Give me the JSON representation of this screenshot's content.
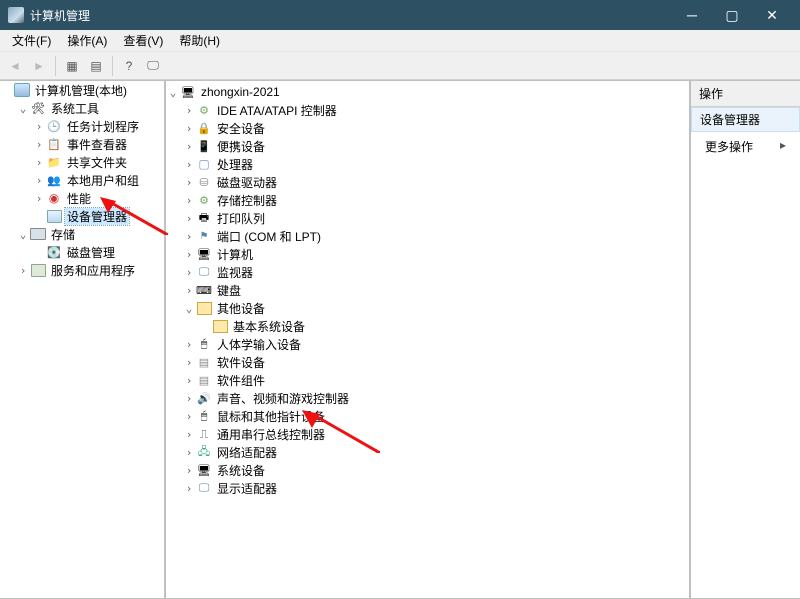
{
  "window": {
    "title": "计算机管理"
  },
  "menu": {
    "file": "文件(F)",
    "action": "操作(A)",
    "view": "查看(V)",
    "help": "帮助(H)"
  },
  "left_tree": {
    "root": "计算机管理(本地)",
    "system_tools": {
      "label": "系统工具",
      "children": {
        "task_scheduler": "任务计划程序",
        "event_viewer": "事件查看器",
        "shared_folders": "共享文件夹",
        "local_users": "本地用户和组",
        "performance": "性能",
        "device_manager": "设备管理器"
      }
    },
    "storage": {
      "label": "存储",
      "disk_mgmt": "磁盘管理"
    },
    "services": "服务和应用程序"
  },
  "center_tree": {
    "computer": "zhongxin-2021",
    "nodes": {
      "ide": "IDE ATA/ATAPI 控制器",
      "security": "安全设备",
      "portable": "便携设备",
      "processors": "处理器",
      "diskdrives": "磁盘驱动器",
      "storagectl": "存储控制器",
      "printq": "打印队列",
      "ports": "端口 (COM 和 LPT)",
      "computers": "计算机",
      "monitors": "监视器",
      "keyboards": "键盘",
      "other": "其他设备",
      "other_child": "基本系统设备",
      "hid": "人体学输入设备",
      "softdev": "软件设备",
      "softcomp": "软件组件",
      "sound": "声音、视频和游戏控制器",
      "mice": "鼠标和其他指针设备",
      "usb": "通用串行总线控制器",
      "network": "网络适配器",
      "sysdev": "系统设备",
      "display": "显示适配器"
    }
  },
  "right_panel": {
    "header": "操作",
    "section": "设备管理器",
    "more": "更多操作"
  }
}
